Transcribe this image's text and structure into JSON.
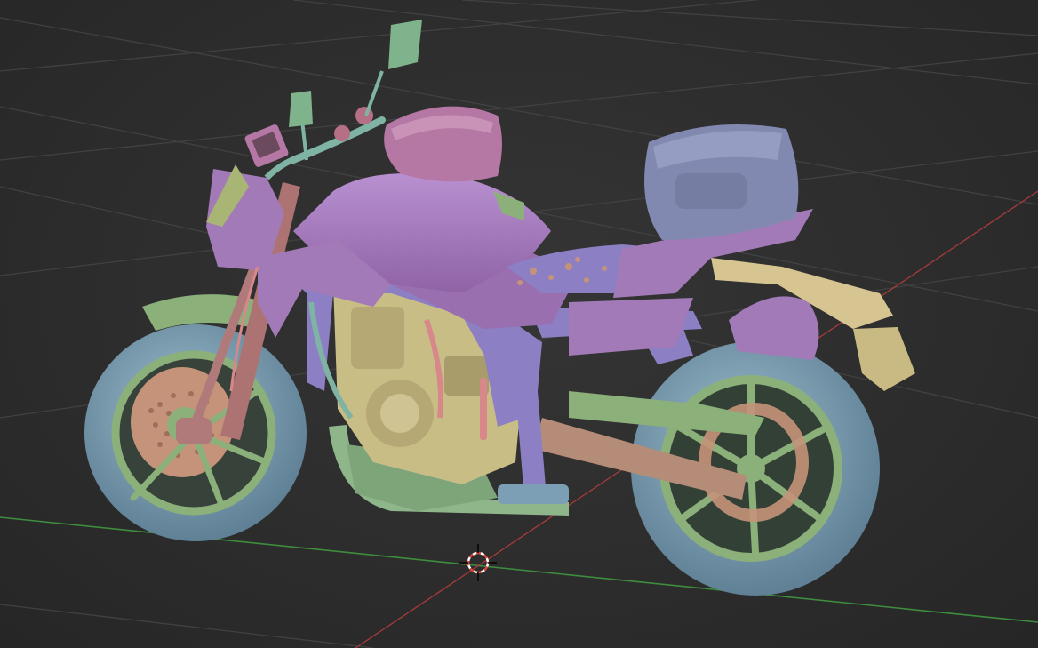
{
  "viewport": {
    "background_color": "#2d2d2d",
    "grid_color": "#3f3f3f",
    "x_axis_color": "#b33a3a",
    "y_axis_color": "#3e8c3e"
  },
  "model": {
    "palette": {
      "frame": "#8c7fc4",
      "bodywork": "#a37ab8",
      "tyre": "#7d9fb5",
      "rim": "#8cb07a",
      "engine": "#c9bd86",
      "brake_disc": "#c49379",
      "swingarm": "#b58c78",
      "fork": "#ad7373",
      "exhaust": "#8fb58a",
      "tail_bag": "#8289b0",
      "tank_bag": "#b577a3",
      "license_bracket": "#d6c590"
    }
  },
  "cursor_3d": {
    "icon": "3d-cursor-icon"
  }
}
